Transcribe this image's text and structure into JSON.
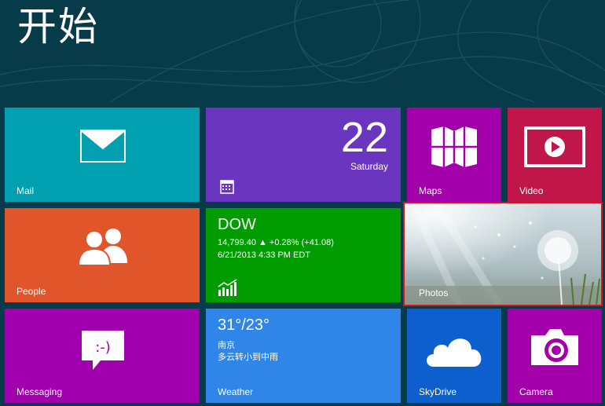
{
  "screen": {
    "title": "开始"
  },
  "colors": {
    "background": "#073b4a",
    "mail": "#00a0b1",
    "calendar": "#6a36bf",
    "maps": "#a300ab",
    "video": "#c1164a",
    "people": "#e0552a",
    "finance": "#009c00",
    "messaging": "#a000ad",
    "weather": "#2f86e8",
    "skydrive": "#0c5fcc",
    "camera": "#a300ab",
    "selection": "#d01818"
  },
  "tiles": {
    "mail": {
      "label": "Mail",
      "icon": "envelope-icon"
    },
    "calendar": {
      "day": "22",
      "weekday": "Saturday",
      "icon": "calendar-icon"
    },
    "maps": {
      "label": "Maps",
      "icon": "map-icon"
    },
    "video": {
      "label": "Video",
      "icon": "play-icon"
    },
    "people": {
      "label": "People",
      "icon": "people-icon"
    },
    "finance": {
      "index": "DOW",
      "quote": "14,799.40 ▲ +0.28% (+41.08)",
      "timestamp": "6/21/2013 4:33 PM EDT",
      "icon": "chart-icon"
    },
    "photos": {
      "label": "Photos"
    },
    "messaging": {
      "label": "Messaging",
      "icon": "chat-bubble-icon"
    },
    "weather": {
      "label": "Weather",
      "temp": "31°/23°",
      "city": "南京",
      "condition": "多云转小到中雨"
    },
    "skydrive": {
      "label": "SkyDrive",
      "icon": "cloud-icon"
    },
    "camera": {
      "label": "Camera",
      "icon": "camera-icon"
    }
  }
}
